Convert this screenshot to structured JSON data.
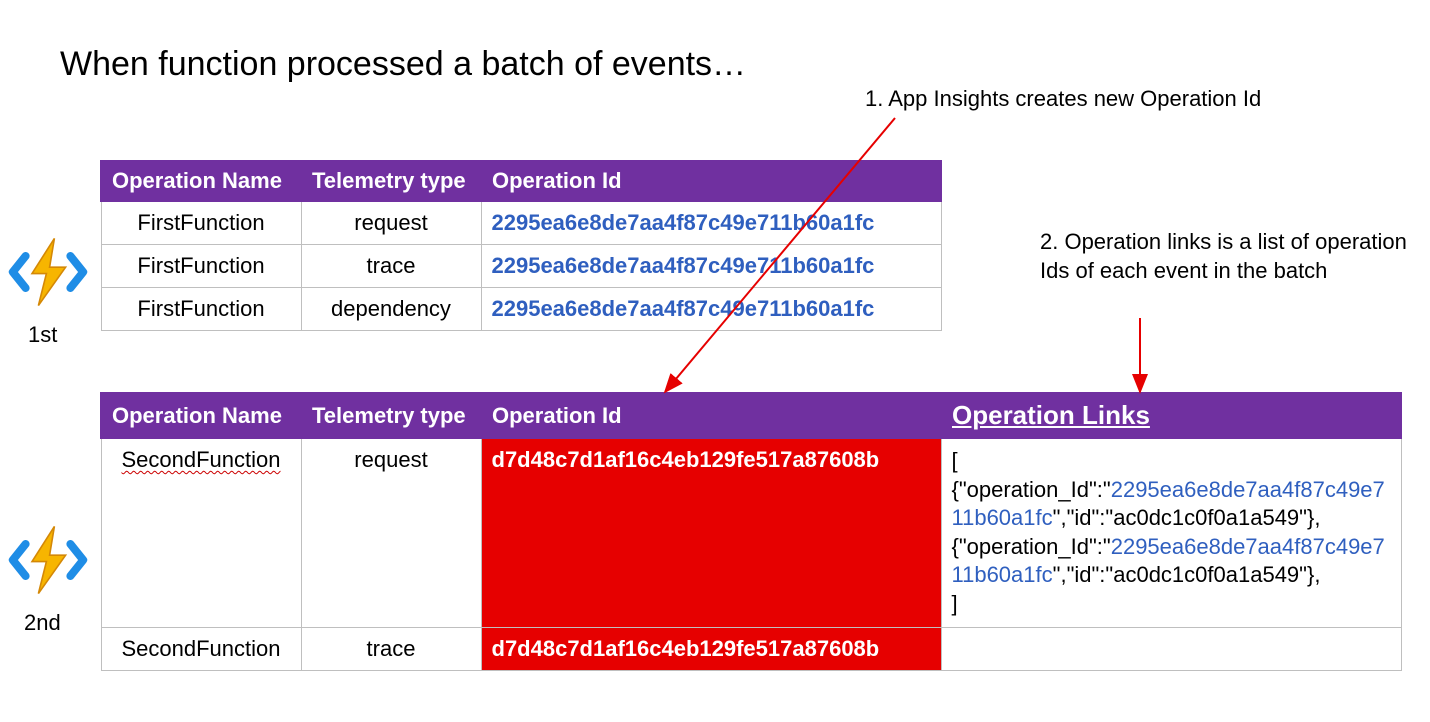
{
  "title": "When function processed a batch of events…",
  "annotations": {
    "a1": "1. App Insights creates new Operation Id",
    "a2": "2. Operation links is a list of operation Ids of each event in the batch"
  },
  "labels": {
    "first": "1st",
    "second": "2nd"
  },
  "table1": {
    "headers": {
      "h1": "Operation Name",
      "h2": "Telemetry type",
      "h3": "Operation Id"
    },
    "rows": [
      {
        "name": "FirstFunction",
        "type": "request",
        "opId": "2295ea6e8de7aa4f87c49e711b60a1fc"
      },
      {
        "name": "FirstFunction",
        "type": "trace",
        "opId": "2295ea6e8de7aa4f87c49e711b60a1fc"
      },
      {
        "name": "FirstFunction",
        "type": "dependency",
        "opId": "2295ea6e8de7aa4f87c49e711b60a1fc"
      }
    ]
  },
  "table2": {
    "headers": {
      "h1": "Operation Name",
      "h2": "Telemetry type",
      "h3": "Operation Id",
      "h4": "Operation Links"
    },
    "rows": [
      {
        "name": "SecondFunction",
        "type": "request",
        "opId": "d7d48c7d1af16c4eb129fe517a87608b"
      },
      {
        "name": "SecondFunction",
        "type": "trace",
        "opId": "d7d48c7d1af16c4eb129fe517a87608b"
      }
    ],
    "opLinks": {
      "open": "[",
      "k1": "{\"operation_Id\":\"",
      "v1": "2295ea6e8de7aa4f87c49e711b60a1fc",
      "k2": "\",\"id\":\"ac0dc1c0f0a1a549\"},",
      "k3": "{\"operation_Id\":\"",
      "v2": "2295ea6e8de7aa4f87c49e711b60a1fc",
      "k4": "\",\"id\":\"ac0dc1c0f0a1a549\"},",
      "close": "]"
    }
  }
}
